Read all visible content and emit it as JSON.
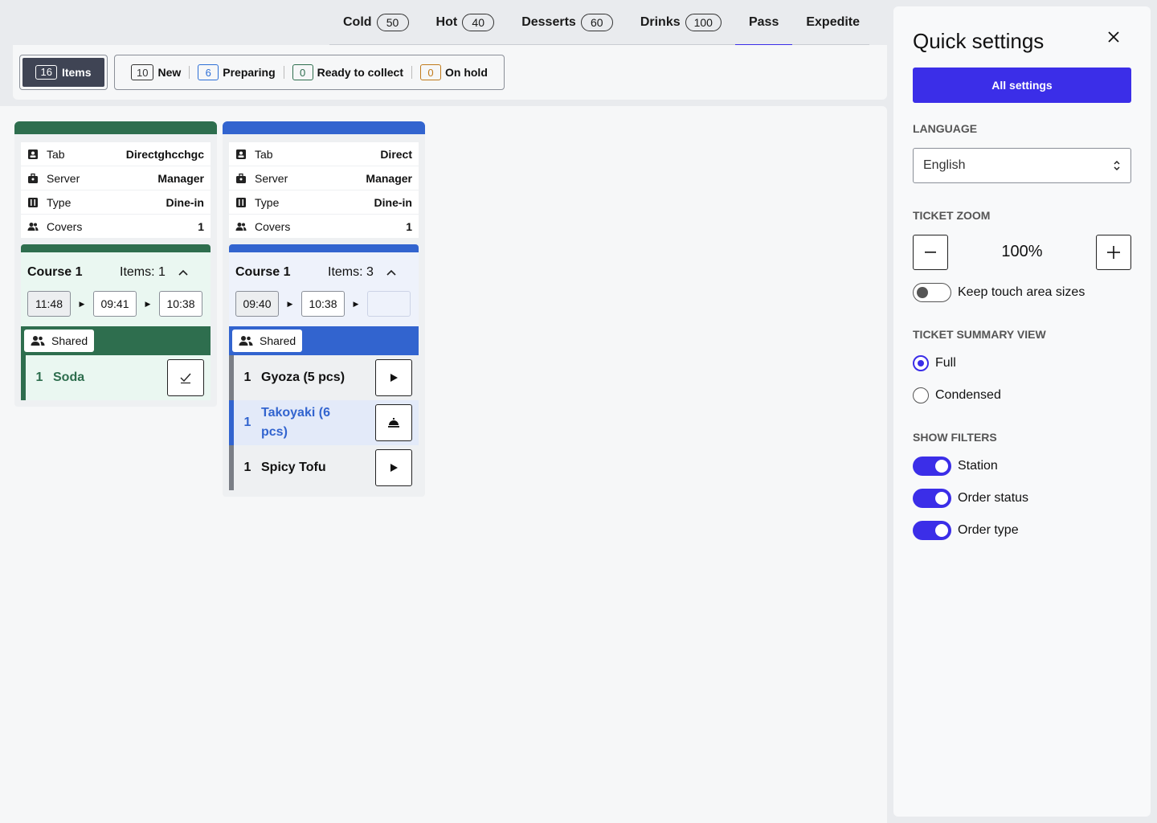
{
  "tabs": [
    {
      "label": "Cold",
      "count": "50"
    },
    {
      "label": "Hot",
      "count": "40"
    },
    {
      "label": "Desserts",
      "count": "60"
    },
    {
      "label": "Drinks",
      "count": "100"
    },
    {
      "label": "Pass",
      "count": null,
      "active": true
    },
    {
      "label": "Expedite",
      "count": null
    }
  ],
  "filters": {
    "items": {
      "count": "16",
      "label": "Items"
    },
    "statuses": [
      {
        "count": "10",
        "label": "New",
        "color": "#333333"
      },
      {
        "count": "6",
        "label": "Preparing",
        "color": "#2d6fd6"
      },
      {
        "count": "0",
        "label": "Ready to collect",
        "color": "#2e6e4e"
      },
      {
        "count": "0",
        "label": "On hold",
        "color": "#c07a1a"
      }
    ]
  },
  "tickets": [
    {
      "color": "#2e6e4e",
      "bg": "#eaf7f1",
      "info": [
        {
          "key": "Tab",
          "value": "Directghcchgc",
          "icon": "id-card-icon"
        },
        {
          "key": "Server",
          "value": "Manager",
          "icon": "briefcase-icon"
        },
        {
          "key": "Type",
          "value": "Dine-in",
          "icon": "cutlery-icon"
        },
        {
          "key": "Covers",
          "value": "1",
          "icon": "people-icon"
        }
      ],
      "course": {
        "title": "Course 1",
        "items": "Items: 1",
        "times": [
          "11:48",
          "09:41",
          "10:38"
        ]
      },
      "shared": "Shared",
      "lines": [
        {
          "qty": "1",
          "name": "Soda",
          "action": "check-icon"
        }
      ]
    },
    {
      "color": "#3264cf",
      "bg": "#eef2fb",
      "info": [
        {
          "key": "Tab",
          "value": "Direct",
          "icon": "id-card-icon"
        },
        {
          "key": "Server",
          "value": "Manager",
          "icon": "briefcase-icon"
        },
        {
          "key": "Type",
          "value": "Dine-in",
          "icon": "cutlery-icon"
        },
        {
          "key": "Covers",
          "value": "1",
          "icon": "people-icon"
        }
      ],
      "course": {
        "title": "Course 1",
        "items": "Items: 3",
        "times": [
          "09:40",
          "10:38",
          ""
        ]
      },
      "shared": "Shared",
      "lines": [
        {
          "qty": "1",
          "name": "Gyoza (5 pcs)",
          "action": "play-icon"
        },
        {
          "qty": "1",
          "name": "Takoyaki (6 pcs)",
          "action": "cloche-icon",
          "highlight": true
        },
        {
          "qty": "1",
          "name": "Spicy Tofu",
          "action": "play-icon"
        }
      ]
    }
  ],
  "settings": {
    "title": "Quick settings",
    "all_settings": "All settings",
    "language_label": "LANGUAGE",
    "language_value": "English",
    "zoom_label": "TICKET ZOOM",
    "zoom_value": "100%",
    "keep_touch": "Keep touch area sizes",
    "summary_label": "TICKET SUMMARY VIEW",
    "summary_options": [
      "Full",
      "Condensed"
    ],
    "summary_selected": "Full",
    "filters_label": "SHOW FILTERS",
    "filter_toggles": [
      "Station",
      "Order status",
      "Order type"
    ],
    "accent": "#3b2ee8"
  }
}
